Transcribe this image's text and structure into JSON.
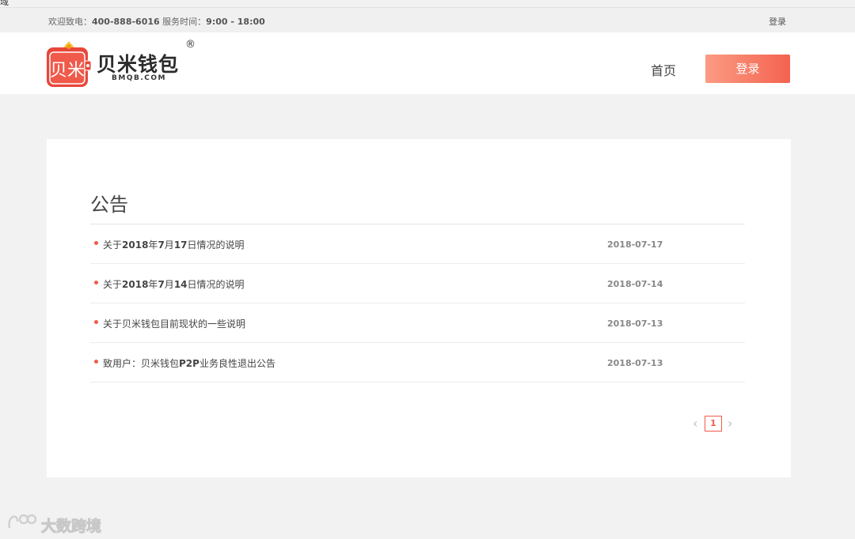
{
  "stray_char": "域",
  "topbar": {
    "hotline_label": "欢迎致电：",
    "hotline_number": "400-888-6016",
    "hours_label": "服务时间：",
    "hours_value": "9:00 - 18:00",
    "login_link": "登录"
  },
  "header": {
    "logo_glyph": "贝米",
    "brand_name": "贝米钱包",
    "brand_domain": "BMQB.COM",
    "reg_mark": "®",
    "nav_home": "首页",
    "login_button": "登录",
    "accent_color": "#f4634f"
  },
  "notice": {
    "title": "公告",
    "items": [
      {
        "title_pre": "关于",
        "title_bold": "2018",
        "title_mid": "年",
        "title_bold2": "7",
        "title_mid2": "月",
        "title_bold3": "17",
        "title_post": "日情况的说明",
        "date": "2018-07-17"
      },
      {
        "title_pre": "关于",
        "title_bold": "2018",
        "title_mid": "年",
        "title_bold2": "7",
        "title_mid2": "月",
        "title_bold3": "14",
        "title_post": "日情况的说明",
        "date": "2018-07-14"
      },
      {
        "title_pre": "关于贝米钱包目前现状的一些说明",
        "title_bold": "",
        "title_mid": "",
        "title_bold2": "",
        "title_mid2": "",
        "title_bold3": "",
        "title_post": "",
        "date": "2018-07-13"
      },
      {
        "title_pre": "致用户：贝米钱包",
        "title_bold": "P2P",
        "title_mid": "业务良性退出公告",
        "title_bold2": "",
        "title_mid2": "",
        "title_bold3": "",
        "title_post": "",
        "date": "2018-07-13"
      }
    ]
  },
  "pagination": {
    "prev": "‹",
    "current": "1",
    "next": "›"
  },
  "watermark": {
    "text": "大数跨境"
  }
}
